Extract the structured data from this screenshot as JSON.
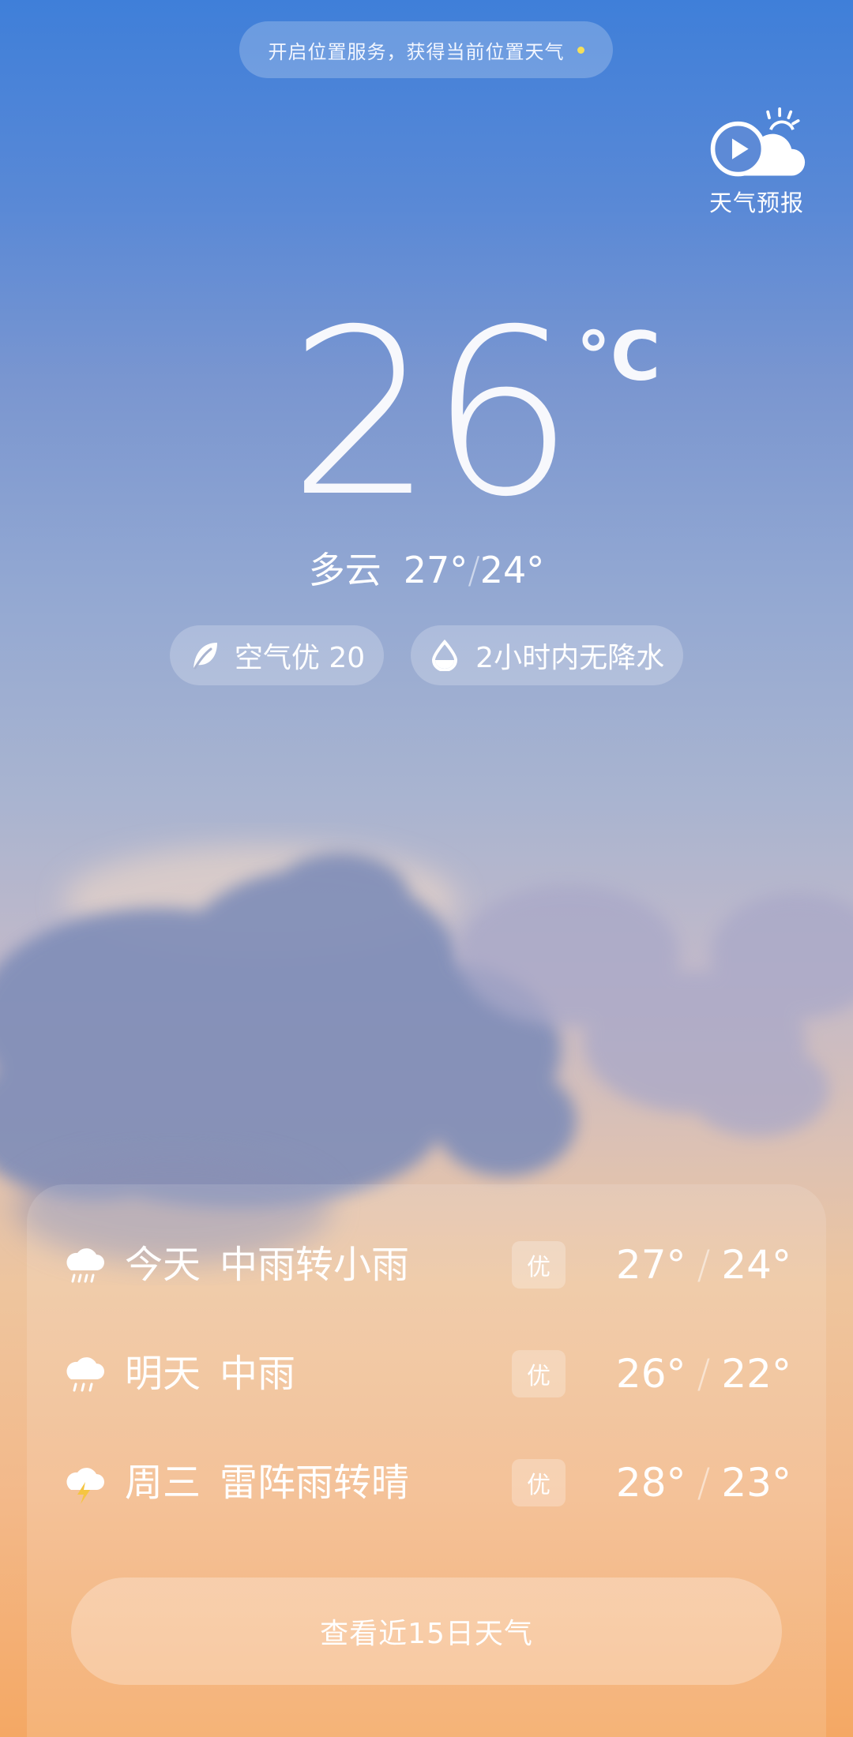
{
  "location_banner": {
    "text": "开启位置服务，获得当前位置天气"
  },
  "forecast_video": {
    "label": "天气预报"
  },
  "current": {
    "temperature": "26",
    "unit": "°C",
    "condition": "多云",
    "high": "27°",
    "low": "24°",
    "separator": "/"
  },
  "chips": {
    "air": {
      "label": "空气优 20",
      "icon": "leaf-icon"
    },
    "rain": {
      "label": "2小时内无降水",
      "icon": "water-drop-icon"
    }
  },
  "forecast": [
    {
      "day": "今天",
      "desc": "中雨转小雨",
      "aqi": "优",
      "high": "27°",
      "low": "24°",
      "icon": "rain-cloud-icon"
    },
    {
      "day": "明天",
      "desc": "中雨",
      "aqi": "优",
      "high": "26°",
      "low": "22°",
      "icon": "rain-cloud-icon"
    },
    {
      "day": "周三",
      "desc": "雷阵雨转晴",
      "aqi": "优",
      "high": "28°",
      "low": "23°",
      "icon": "thunder-cloud-icon"
    }
  ],
  "forecast_separator": "/",
  "cta": {
    "label": "查看近15日天气"
  },
  "colors": {
    "sky_top": "#3f7fd9",
    "sky_bottom": "#f4a864",
    "banner_dot": "#f5e05a",
    "thunder_bolt": "#f5c542"
  }
}
